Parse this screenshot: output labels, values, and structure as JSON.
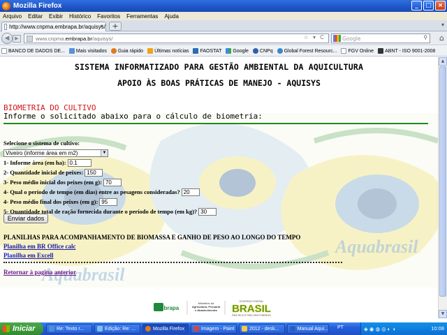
{
  "window": {
    "title": "Mozilla Firefox"
  },
  "menu": [
    "Arquivo",
    "Editar",
    "Exibir",
    "Histórico",
    "Favoritos",
    "Ferramentas",
    "Ajuda"
  ],
  "tab": {
    "label": "http://www.cnpma.embrapa.br/aquisys/"
  },
  "urlbar": {
    "prefix": "www.cnpma.",
    "domain": "embrapa.br",
    "path": "/aquisys/"
  },
  "search": {
    "placeholder": "Google"
  },
  "bookmarks": [
    "BANCO DE DADOS DE...",
    "Mais visitados",
    "Guia rápido",
    "Últimas notícias",
    "FAOSTAT",
    "Google",
    "CNPq",
    "Global Forest Resourc...",
    "FGV Online",
    "ABNT - ISO 9001-2008"
  ],
  "page": {
    "header1": "SISTEMA INFORMATIZADO PARA GESTÃO AMBIENTAL DA AQUICULTURA",
    "header2": "APOIO ÀS BOAS PRÁTICAS DE MANEJO - AQUISYS",
    "section_title": "BIOMETRIA DO CULTIVO",
    "section_sub": "Informe o solicitado abaixo para o cálculo de biometria:",
    "select_label": "Selecione o sistema de cultivo:",
    "select_value": "Viveiro (informe área em m2)",
    "fields": [
      {
        "label": "1- Informe área (em ha):",
        "value": "0.1"
      },
      {
        "label": "2- Quantidade inicial de peixes:",
        "value": "150"
      },
      {
        "label": "3- Peso médio inicial dos peixes (em g):",
        "value": "70"
      },
      {
        "label": "4- Qual o período de tempo (em dias) entre as pesagens consideradas?",
        "value": "20"
      },
      {
        "label": "4- Peso médio final dos peixes (em g):",
        "value": "95"
      },
      {
        "label": "5- Quantidade total de ração fornecida durante o período de tempo (em kg)?",
        "value": "30"
      }
    ],
    "send_button": "Enviar dados",
    "planilhas_title": "PLANILHAS PARA ACOMPANHAMENTO DE BIOMASSA E GANHO DE PESO AO LONGO DO TEMPO",
    "link_broffice": "Planilha em BR Office calc",
    "link_excel": "Planilha em Excell",
    "back_link": "Retornar à pagina anterior",
    "watermark": "Aquabrasil",
    "footer_embrapa": "Embrapa",
    "footer_ministerio": "Ministério da Agricultura, Pecuária e Abastecimento",
    "footer_brasil": "BRASIL",
    "footer_gov": "GOVERNO FEDERAL",
    "footer_slogan": "PAÍS RICO É PAÍS SEM POBREZA"
  },
  "taskbar": {
    "start": "Iniciar",
    "tasks": [
      "Re: Texto r...",
      "Edição: Re: ...",
      "Mozilla Firefox",
      "Imagem - Paint",
      "2012 - desk...",
      "Manual Aqui..."
    ],
    "lang": "PT",
    "clock": "10:08"
  },
  "colors": {
    "section_title": "#d01818",
    "rule": "#1e8a1e",
    "link": "#1a1aa6",
    "visited": "#6a1b8a"
  }
}
